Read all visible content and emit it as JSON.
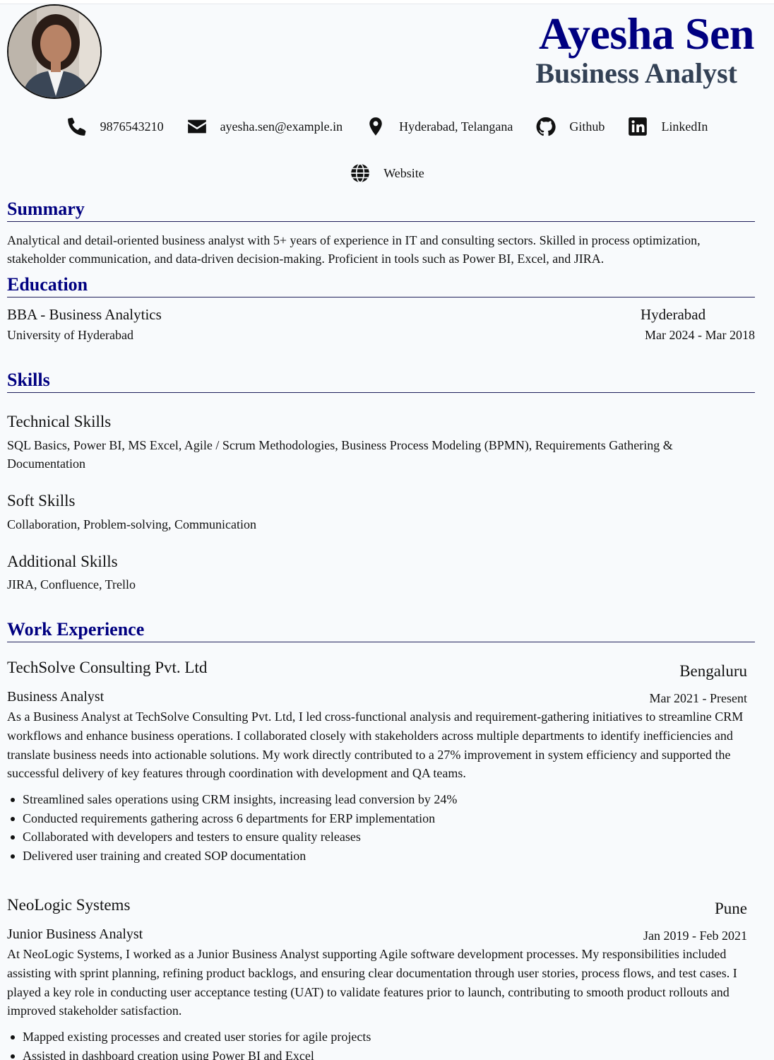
{
  "header": {
    "name": "Ayesha Sen",
    "title": "Business Analyst"
  },
  "contacts": [
    {
      "icon": "phone-icon",
      "label": "9876543210"
    },
    {
      "icon": "email-icon",
      "label": "ayesha.sen@example.in"
    },
    {
      "icon": "location-icon",
      "label": "Hyderabad, Telangana"
    },
    {
      "icon": "github-icon",
      "label": "Github"
    },
    {
      "icon": "linkedin-icon",
      "label": "LinkedIn"
    },
    {
      "icon": "globe-icon",
      "label": "Website"
    }
  ],
  "summary": {
    "heading": "Summary",
    "text": "Analytical and detail-oriented business analyst with 5+ years of experience in IT and consulting sectors. Skilled in process optimization, stakeholder communication, and data-driven decision-making. Proficient in tools such as Power BI, Excel, and JIRA."
  },
  "education": {
    "heading": "Education",
    "degree": "BBA - Business Analytics",
    "school": "University of Hyderabad",
    "location": "Hyderabad",
    "dates": "Mar 2024 - Mar 2018"
  },
  "skills": {
    "heading": "Skills",
    "technical_title": "Technical Skills",
    "technical_text": "SQL Basics, Power BI, MS Excel, Agile / Scrum Methodologies, Business Process Modeling (BPMN), Requirements Gathering & Documentation",
    "soft_title": "Soft Skills",
    "soft_text": "Collaboration, Problem-solving, Communication",
    "additional_title": "Additional Skills",
    "additional_text": "JIRA, Confluence, Trello"
  },
  "experience": {
    "heading": "Work Experience",
    "jobs": [
      {
        "company": "TechSolve Consulting Pvt. Ltd",
        "location": "Bengaluru",
        "role": "Business Analyst",
        "dates": "Mar 2021 - Present",
        "description": "As a Business Analyst at TechSolve Consulting Pvt. Ltd, I led cross-functional analysis and requirement-gathering initiatives to streamline CRM workflows and enhance business operations. I collaborated closely with stakeholders across multiple departments to identify inefficiencies and translate business needs into actionable solutions. My work directly contributed to a 27% improvement in system efficiency and supported the successful delivery of key features through coordination with development and QA teams.",
        "bullets": [
          "Streamlined sales operations using CRM insights, increasing lead conversion by 24%",
          "Conducted requirements gathering across 6 departments for ERP implementation",
          "Collaborated with developers and testers to ensure quality releases",
          "Delivered user training and created SOP documentation"
        ]
      },
      {
        "company": "NeoLogic Systems",
        "location": "Pune",
        "role": "Junior Business Analyst",
        "dates": "Jan 2019 - Feb 2021",
        "description": "At NeoLogic Systems, I worked as a Junior Business Analyst supporting Agile software development processes. My responsibilities included assisting with sprint planning, refining product backlogs, and ensuring clear documentation through user stories, process flows, and test cases. I played a key role in conducting user acceptance testing (UAT) to validate features prior to launch, contributing to smooth product rollouts and improved stakeholder satisfaction.",
        "bullets": [
          "Mapped existing processes and created user stories for agile projects",
          "Assisted in dashboard creation using Power BI and Excel"
        ]
      }
    ]
  }
}
